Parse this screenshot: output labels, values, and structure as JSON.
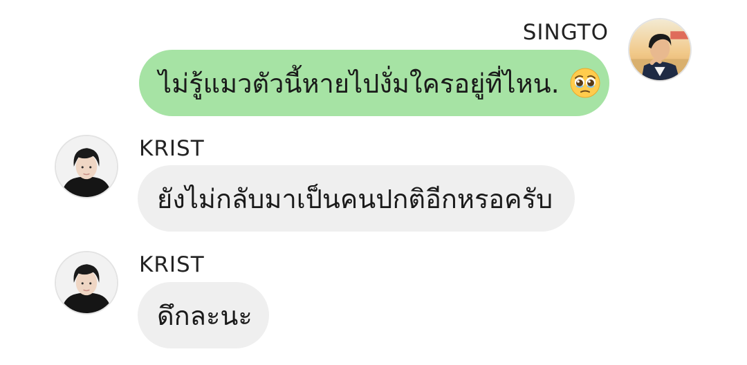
{
  "messages": [
    {
      "sender": "SINGTO",
      "text": "ไม่รู้แมวตัวนี้หายไปงั่มใครอยู่ที่ไหน.",
      "emoji": "pleading-face-emoji",
      "side": "outgoing"
    },
    {
      "sender": "KRIST",
      "text": "ยังไม่กลับมาเป็นคนปกติอีกหรอครับ",
      "side": "incoming"
    },
    {
      "sender": "KRIST",
      "text": "ดึกละนะ",
      "side": "incoming"
    }
  ],
  "colors": {
    "outgoing_bubble": "#a6e3a4",
    "incoming_bubble": "#efefef",
    "text": "#1a1a1a",
    "name": "#222222"
  }
}
